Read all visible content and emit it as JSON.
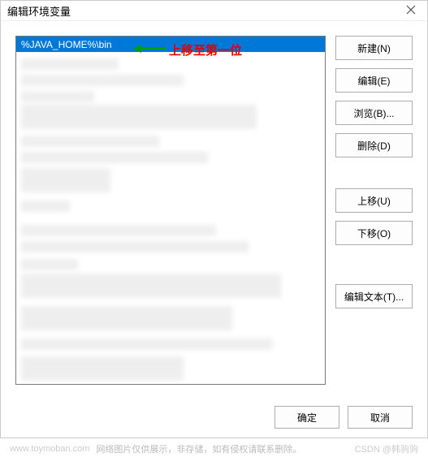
{
  "dialog": {
    "title": "编辑环境变量"
  },
  "list": {
    "selected_item": "%JAVA_HOME%\\bin"
  },
  "buttons": {
    "new": "新建(N)",
    "edit": "编辑(E)",
    "browse": "浏览(B)...",
    "delete": "删除(D)",
    "move_up": "上移(U)",
    "move_down": "下移(O)",
    "edit_text": "编辑文本(T)...",
    "ok": "确定",
    "cancel": "取消"
  },
  "annotation": {
    "text": "上移至第一位"
  },
  "watermark": {
    "site": "www.toymoban.com",
    "note": "网络图片仅供展示，非存储，如有侵权请联系删除。",
    "author": "CSDN @韩驹驹"
  }
}
